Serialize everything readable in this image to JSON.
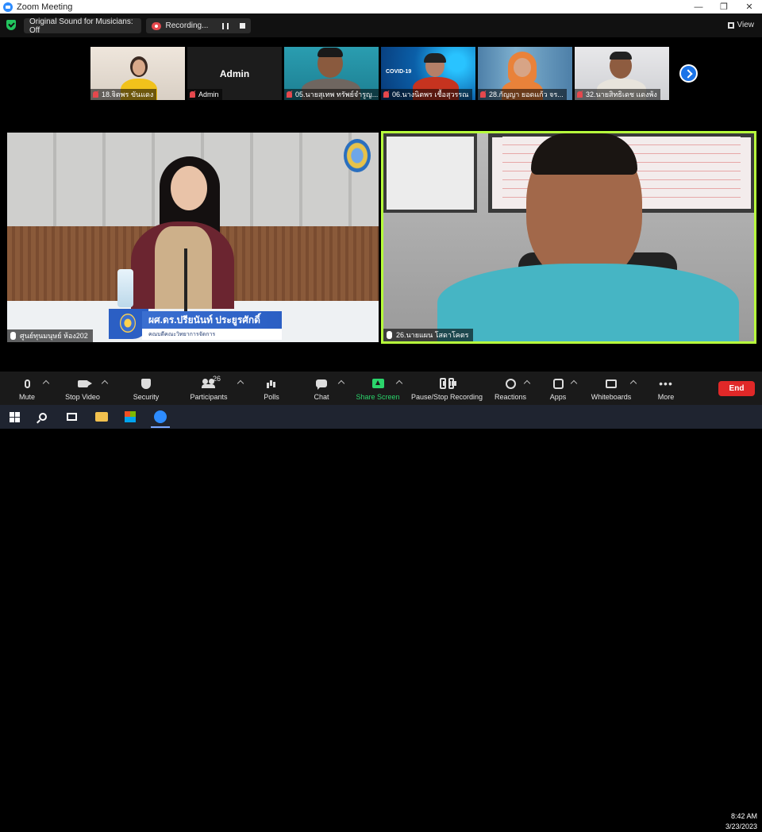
{
  "window": {
    "title": "Zoom Meeting",
    "minimize": "—",
    "restore": "❐",
    "close": "✕"
  },
  "topbar": {
    "sound": "Original Sound for Musicians: Off",
    "recording": "Recording...",
    "view": "View"
  },
  "thumbnails": [
    {
      "name": "18.จิตพร ขันแดง",
      "muted": true
    },
    {
      "name": "Admin",
      "display": "Admin",
      "muted": true
    },
    {
      "name": "05.นายสุเทพ ทรัพย์จำรูญ...",
      "muted": true
    },
    {
      "name": "06.นางนิตพร เชื้อสุวรรณ",
      "muted": true,
      "badge": "COVID-19"
    },
    {
      "name": "28.กัญญา ยอดแก้ว จร...",
      "muted": true
    },
    {
      "name": "32.นายสิทธิเดช แดงพ้ง",
      "muted": true
    }
  ],
  "main_videos": {
    "left": {
      "name": "ศูนย์ทุนมนุษย์ ห้อง202",
      "caption_title": "ผศ.ดร.ปรียนันท์ ประยูรศักดิ์",
      "caption_sub": "คณบดีคณะวิทยาการจัดการ"
    },
    "right": {
      "name": "26.นายแผน โสดาโคตร"
    }
  },
  "toolbar": {
    "mute": "Mute",
    "stop_video": "Stop Video",
    "security": "Security",
    "participants": "Participants",
    "participant_count": "26",
    "polls": "Polls",
    "chat": "Chat",
    "share_screen": "Share Screen",
    "pause_recording": "Pause/Stop Recording",
    "reactions": "Reactions",
    "apps": "Apps",
    "whiteboards": "Whiteboards",
    "more": "More",
    "more_glyph": "•••",
    "end": "End"
  },
  "taskbar": {
    "time": "8:42 AM",
    "date": "3/23/2023"
  },
  "colors": {
    "accent": "#2D8CFF",
    "active_speaker": "#b7ff3c",
    "end": "#e02828",
    "share": "#2bd46b"
  }
}
